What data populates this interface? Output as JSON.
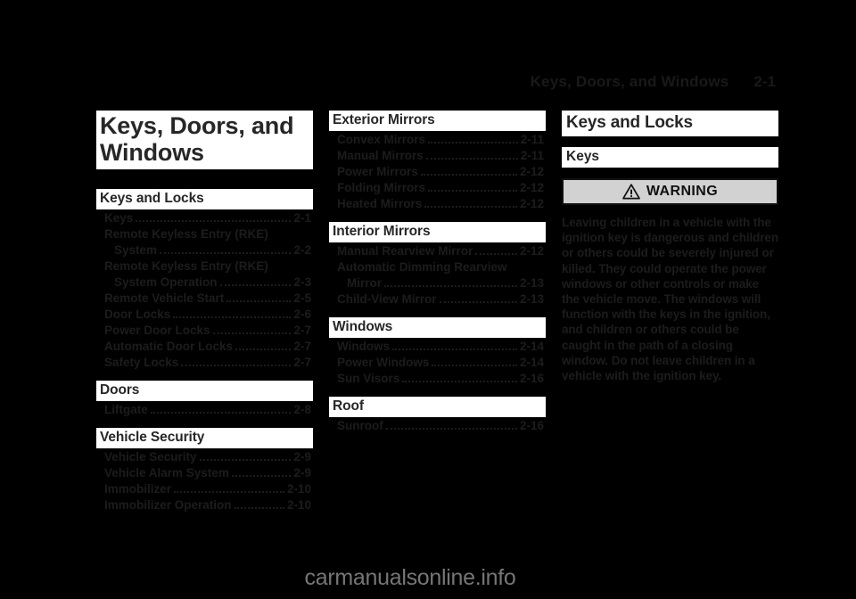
{
  "header": {
    "title": "Keys, Doors, and Windows",
    "page_number": "2-1"
  },
  "chapter_title": "Keys, Doors, and Windows",
  "toc": {
    "column1": [
      {
        "heading": "Keys and Locks",
        "entries": [
          {
            "label": "Keys",
            "page": "2-1",
            "indent": false,
            "dots": true
          },
          {
            "label": "Remote Keyless Entry (RKE)",
            "page": "",
            "indent": false,
            "dots": false
          },
          {
            "label": "System",
            "page": "2-2",
            "indent": true,
            "dots": true
          },
          {
            "label": "Remote Keyless Entry (RKE)",
            "page": "",
            "indent": false,
            "dots": false
          },
          {
            "label": "System Operation",
            "page": "2-3",
            "indent": true,
            "dots": true
          },
          {
            "label": "Remote Vehicle Start",
            "page": "2-5",
            "indent": false,
            "dots": true
          },
          {
            "label": "Door Locks",
            "page": "2-6",
            "indent": false,
            "dots": true
          },
          {
            "label": "Power Door Locks",
            "page": "2-7",
            "indent": false,
            "dots": true
          },
          {
            "label": "Automatic Door Locks",
            "page": "2-7",
            "indent": false,
            "dots": true
          },
          {
            "label": "Safety Locks",
            "page": "2-7",
            "indent": false,
            "dots": true
          }
        ]
      },
      {
        "heading": "Doors",
        "entries": [
          {
            "label": "Liftgate",
            "page": "2-8",
            "indent": false,
            "dots": true
          }
        ]
      },
      {
        "heading": "Vehicle Security",
        "entries": [
          {
            "label": "Vehicle Security",
            "page": "2-9",
            "indent": false,
            "dots": true
          },
          {
            "label": "Vehicle Alarm System",
            "page": "2-9",
            "indent": false,
            "dots": true
          },
          {
            "label": "Immobilizer",
            "page": "2-10",
            "indent": false,
            "dots": true
          },
          {
            "label": "Immobilizer Operation",
            "page": "2-10",
            "indent": false,
            "dots": true
          }
        ]
      }
    ],
    "column2": [
      {
        "heading": "Exterior Mirrors",
        "entries": [
          {
            "label": "Convex Mirrors",
            "page": "2-11",
            "indent": false,
            "dots": true
          },
          {
            "label": "Manual Mirrors",
            "page": "2-11",
            "indent": false,
            "dots": true
          },
          {
            "label": "Power Mirrors",
            "page": "2-12",
            "indent": false,
            "dots": true
          },
          {
            "label": "Folding Mirrors",
            "page": "2-12",
            "indent": false,
            "dots": true
          },
          {
            "label": "Heated Mirrors",
            "page": "2-12",
            "indent": false,
            "dots": true
          }
        ]
      },
      {
        "heading": "Interior Mirrors",
        "entries": [
          {
            "label": "Manual Rearview Mirror",
            "page": "2-12",
            "indent": false,
            "dots": true
          },
          {
            "label": "Automatic Dimming Rearview",
            "page": "",
            "indent": false,
            "dots": false
          },
          {
            "label": "Mirror",
            "page": "2-13",
            "indent": true,
            "dots": true
          },
          {
            "label": "Child-View Mirror",
            "page": "2-13",
            "indent": false,
            "dots": true
          }
        ]
      },
      {
        "heading": "Windows",
        "entries": [
          {
            "label": "Windows",
            "page": "2-14",
            "indent": false,
            "dots": true
          },
          {
            "label": "Power Windows",
            "page": "2-14",
            "indent": false,
            "dots": true
          },
          {
            "label": "Sun Visors",
            "page": "2-16",
            "indent": false,
            "dots": true
          }
        ]
      },
      {
        "heading": "Roof",
        "entries": [
          {
            "label": "Sunroof",
            "page": "2-16",
            "indent": false,
            "dots": true
          }
        ]
      }
    ]
  },
  "content": {
    "h1": "Keys and Locks",
    "h2": "Keys",
    "warning": {
      "icon": "warning-triangle-icon",
      "label": "WARNING",
      "body": "Leaving children in a vehicle with the ignition key is dangerous and children or others could be severely injured or killed. They could operate the power windows or other controls or make the vehicle move. The windows will function with the keys in the ignition, and children or others could be caught in the path of a closing window. Do not leave children in a vehicle with the ignition key."
    }
  },
  "watermark": "carmanualsonline.info",
  "colors": {
    "page_background": "#000000",
    "heading_bar": "#ffffff",
    "heading_text": "#272727",
    "body_text": "#1c1c1c",
    "warning_box": "#d2d2d2",
    "warning_border": "#111111",
    "watermark": "#767676"
  }
}
